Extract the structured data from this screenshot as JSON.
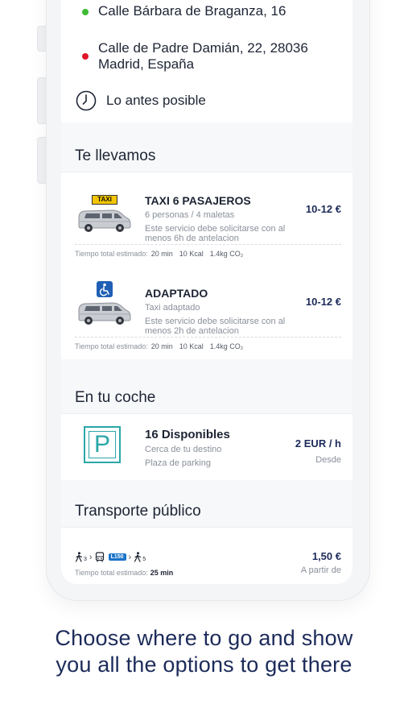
{
  "route": {
    "origin": "Calle Bárbara de Braganza, 16",
    "destination_line1": "Calle de Padre Damián, 22, 28036",
    "destination_line2": "Madrid, España",
    "time": "Lo antes posible"
  },
  "sections": {
    "taxi": "Te llevamos",
    "car": "En tu coche",
    "public": "Transporte público"
  },
  "taxi_options": [
    {
      "badge": "TAXI",
      "title": "TAXI 6 PASAJEROS",
      "subtitle": "6 personas / 4 maletas",
      "note": "Este servicio debe solicitarse con al menos 6h de antelacion",
      "price": "10-12 €",
      "time_label": "Tiempo total estimado:",
      "time_value": "20 min",
      "kcal": "10 Kcal",
      "co2": "1.4kg CO₂"
    },
    {
      "title": "ADAPTADO",
      "subtitle": "Taxi adaptado",
      "note": "Este servicio debe solicitarse con al menos 2h de antelacion",
      "price": "10-12 €",
      "time_label": "Tiempo total estimado:",
      "time_value": "20 min",
      "kcal": "10 Kcal",
      "co2": "1.4kg CO₂"
    }
  ],
  "parking": {
    "icon_letter": "P",
    "title": "16 Disponibles",
    "line1": "Cerca de tu destino",
    "line2": "Plaza de parking",
    "price": "2 EUR / h",
    "from": "Desde"
  },
  "public_transport": {
    "walk1": "3",
    "bus_line": "L150",
    "walk2": "5",
    "price": "1,50 €",
    "from": "A partir de",
    "time_label": "Tiempo total estimado:",
    "time_value": "25 min"
  },
  "caption": {
    "line1": "Choose where to go and show",
    "line2": "you all the options to get there"
  },
  "colors": {
    "origin_dot": "#3dbb35",
    "destination_dot": "#e0142a",
    "accent": "#1c2b5a",
    "parking": "#2aa7a7",
    "taxi_badge": "#f2c500",
    "accessible": "#1f5fb4",
    "bus_line": "#1a73c9"
  }
}
